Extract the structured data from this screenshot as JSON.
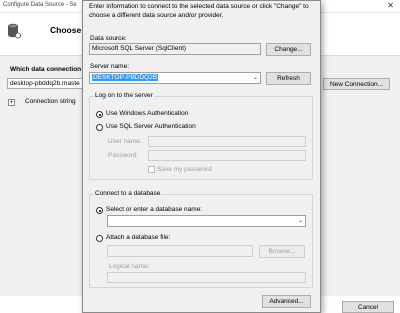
{
  "background_window": {
    "title": "Configure Data Source - Se",
    "close_glyph": "✕",
    "heading": "Choose Y",
    "which_connection_label": "Which data connection",
    "connection_value": "desktop-pbddq2b.maste",
    "new_connection_label": "New Connection...",
    "connection_string_label": "Connection string",
    "cancel_label": "Cancel"
  },
  "dialog": {
    "intro": "Enter information to connect to the selected data source or click \"Change\" to choose a different data source and/or provider.",
    "data_source_label": "Data source:",
    "data_source_value": "Microsoft SQL Server (SqlClient)",
    "change_label": "Change...",
    "server_name_label": "Server name:",
    "server_name_value": "DESKTOP-PBDDQ2B",
    "refresh_label": "Refresh",
    "logon_group": {
      "title": "Log on to the server",
      "windows_auth": "Use Windows Authentication",
      "sql_auth": "Use SQL Server Authentication",
      "user_name_label": "User name:",
      "password_label": "Password:",
      "save_password_label": "Save my password"
    },
    "database_group": {
      "title": "Connect to a database",
      "select_db_label": "Select or enter a database name:",
      "attach_db_label": "Attach a database file:",
      "browse_label": "Browse...",
      "logical_name_label": "Logical name:"
    },
    "advanced_label": "Advanced..."
  }
}
